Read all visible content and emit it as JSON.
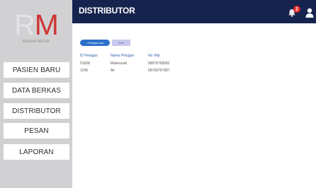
{
  "logo": {
    "letters": "RM",
    "letter_r": "R",
    "letter_m": "M",
    "subtitle": "REKAM MEDIK",
    "accent_color": "#cf3434"
  },
  "sidebar": {
    "items": [
      {
        "label": "PASIEN BARU"
      },
      {
        "label": "DATA BERKAS"
      },
      {
        "label": "DISTRIBUTOR"
      },
      {
        "label": "PESAN"
      },
      {
        "label": "LAPORAN"
      }
    ]
  },
  "header": {
    "title": "DISTRIBUTOR",
    "notification_count": "2",
    "icons": [
      "bell-icon",
      "user-icon"
    ],
    "background_color": "#16234e"
  },
  "toolbar": {
    "add_label": "+ Petugas baru",
    "edit_label": "Edit",
    "add_color": "#2b6fc8"
  },
  "table": {
    "columns": [
      "ID Petugas",
      "Nama Petugas",
      "No Telp"
    ],
    "rows": [
      [
        "01928",
        "Maimunah",
        "08976768282"
      ],
      [
        "1245",
        "Ali",
        "08768767687"
      ]
    ]
  }
}
